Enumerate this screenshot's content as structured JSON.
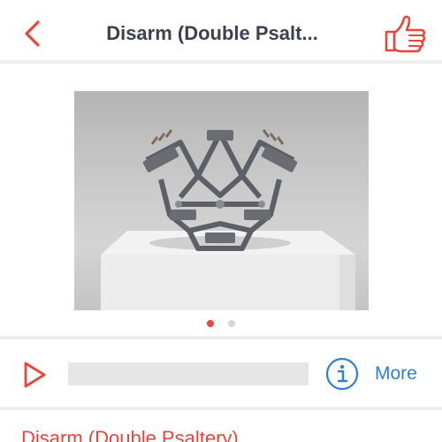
{
  "header": {
    "title": "Disarm (Double Psalt...",
    "back_icon": "chevron-left-icon",
    "like_icon": "thumbs-up-icon"
  },
  "gallery": {
    "image_alt": "Sculpture made of disassembled guns on a white pedestal",
    "page_count": 2,
    "active_page": 1
  },
  "audio": {
    "play_icon": "play-icon",
    "progress": 0,
    "info_icon": "info-icon",
    "more_label": "More"
  },
  "detail": {
    "title": "Disarm (Double Psaltery)"
  },
  "colors": {
    "accent": "#e8453c",
    "link": "#2f7fd6",
    "title_text": "#3c4150",
    "divider": "#eeeeee",
    "track": "#e6e6e6"
  }
}
